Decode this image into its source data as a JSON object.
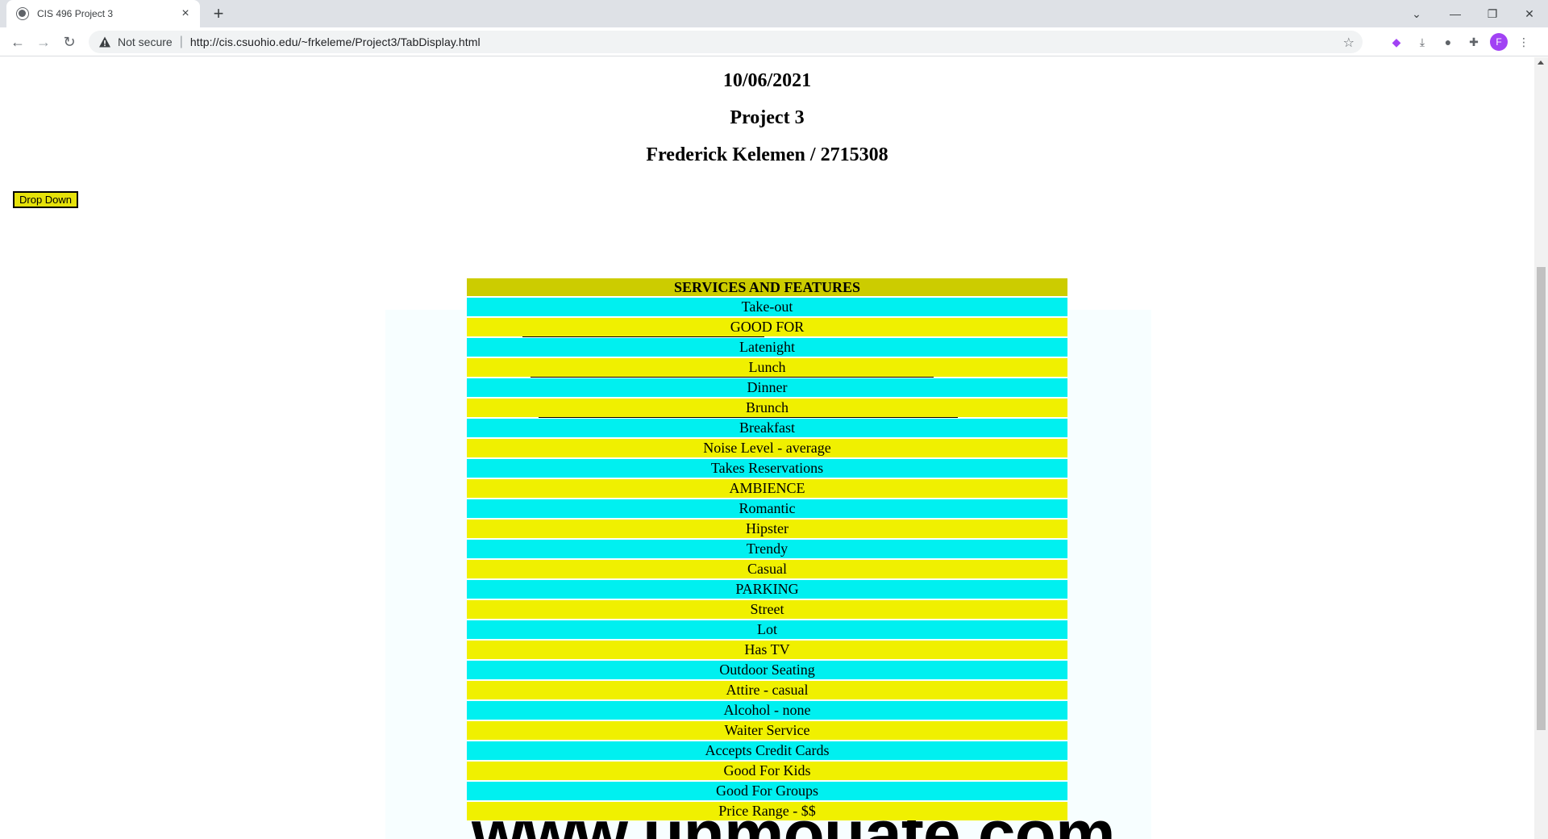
{
  "browser": {
    "tab_title": "CIS 496 Project 3",
    "security_label": "Not secure",
    "url": "http://cis.csuohio.edu/~frkeleme/Project3/TabDisplay.html",
    "profile_initial": "F"
  },
  "page": {
    "date": "10/06/2021",
    "project": "Project 3",
    "author": "Frederick Kelemen / 2715308",
    "dropdown_label": "Drop Down"
  },
  "table": {
    "header": "SERVICES AND FEATURES",
    "rows": [
      "Take-out",
      "GOOD FOR",
      "Latenight",
      "Lunch",
      "Dinner",
      "Brunch",
      "Breakfast",
      "Noise Level - average",
      "Takes Reservations",
      "AMBIENCE",
      "Romantic",
      "Hipster",
      "Trendy",
      "Casual",
      "PARKING",
      "Street",
      "Lot",
      "Has TV",
      "Outdoor Seating",
      "Attire - casual",
      "Alcohol - none",
      "Waiter Service",
      "Accepts Credit Cards",
      "Good For Kids",
      "Good For Groups",
      "Price Range - $$"
    ]
  },
  "colors": {
    "header_bg": "#cccc00",
    "row_cyan": "#00f0f0",
    "row_yellow": "#f0f000",
    "button_bg": "#e6e20a"
  }
}
